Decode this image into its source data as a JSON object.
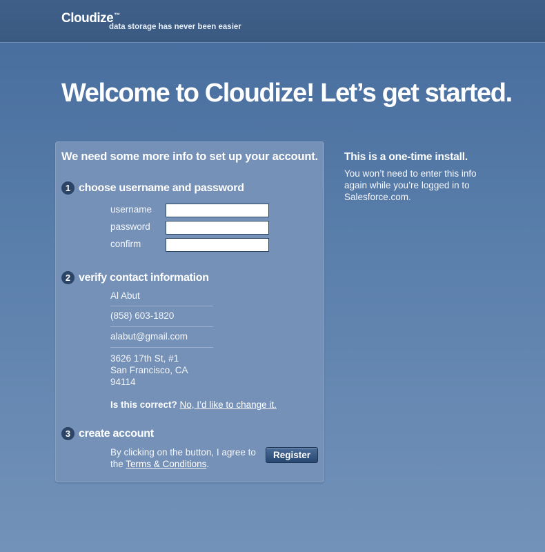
{
  "header": {
    "logo": "Cloudize",
    "trademark": "™",
    "tagline": "data storage has never been easier"
  },
  "headline": "Welcome to Cloudize! Let’s get started.",
  "form": {
    "intro": "We need some more info to set up your account.",
    "step1": {
      "number": "1",
      "title": "choose username and password",
      "fields": [
        {
          "label": "username",
          "value": ""
        },
        {
          "label": "password",
          "value": ""
        },
        {
          "label": "confirm",
          "value": ""
        }
      ]
    },
    "step2": {
      "number": "2",
      "title": "verify contact information",
      "name": "Al Abut",
      "phone": "(858) 603-1820",
      "email": "alabut@gmail.com",
      "address": [
        "3626 17th St, #1",
        "San Francisco, CA",
        "94114"
      ],
      "confirm_question": "Is this correct?",
      "change_link": "No, I’d like to change it."
    },
    "step3": {
      "number": "3",
      "title": "create account",
      "agree_text": "By clicking on the button, I agree to the",
      "terms_link": "Terms & Conditions",
      "agree_suffix": ".",
      "register_label": "Register"
    }
  },
  "sidebar": {
    "title": "This is a one-time install.",
    "text": "You won’t need to enter this info again while you’re logged in to Salesforce.com."
  }
}
